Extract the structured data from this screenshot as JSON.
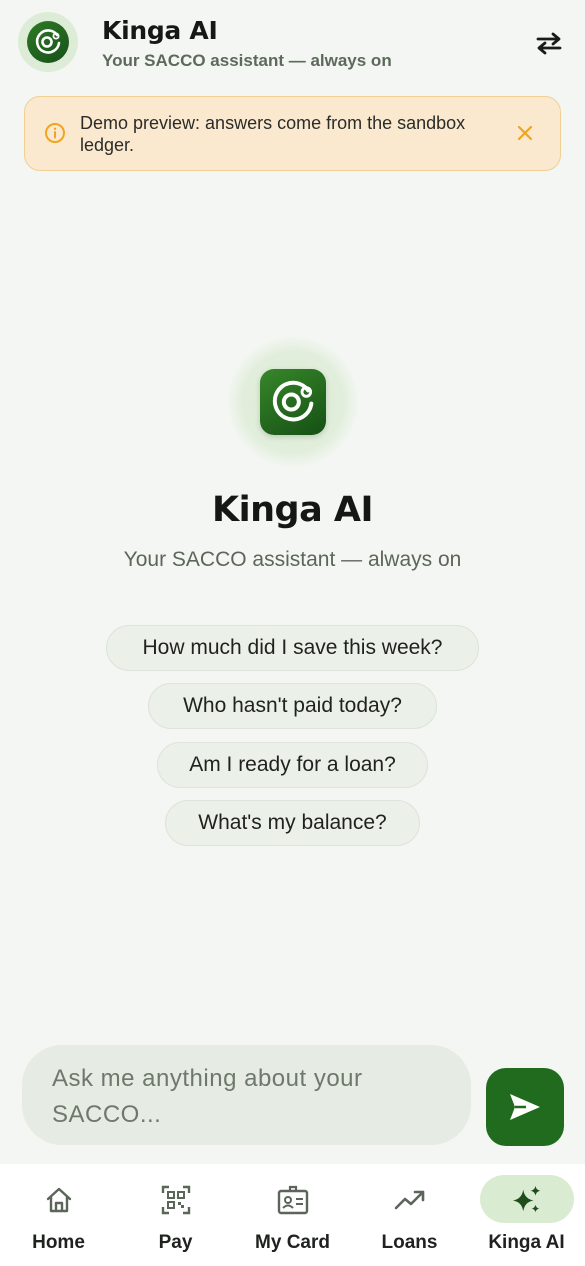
{
  "header": {
    "title": "Kinga AI",
    "subtitle": "Your SACCO assistant — always on",
    "avatar_icon": "kinga-logo-icon",
    "swap_icon": "swap-arrows-icon"
  },
  "banner": {
    "icon": "info-icon",
    "text": "Demo preview: answers come from the sandbox ledger.",
    "close_icon": "close-icon"
  },
  "hero": {
    "logo_icon": "kinga-logo-icon",
    "title": "Kinga AI",
    "subtitle": "Your SACCO assistant — always on"
  },
  "suggestions": [
    "How much did I save this week?",
    "Who hasn't paid today?",
    "Am I ready for a loan?",
    "What's my balance?"
  ],
  "composer": {
    "placeholder": "Ask me anything about your SACCO...",
    "value": "",
    "send_icon": "send-icon"
  },
  "nav": {
    "items": [
      {
        "label": "Home",
        "icon": "home-icon",
        "active": false
      },
      {
        "label": "Pay",
        "icon": "qr-code-icon",
        "active": false
      },
      {
        "label": "My Card",
        "icon": "id-card-icon",
        "active": false
      },
      {
        "label": "Loans",
        "icon": "trending-up-icon",
        "active": false
      },
      {
        "label": "Kinga AI",
        "icon": "sparkles-icon",
        "active": true
      }
    ]
  },
  "colors": {
    "brand": "#216b1e",
    "background": "#f3f6f2",
    "banner_bg": "#fbe9cf",
    "banner_accent": "#f0a51e",
    "active_pill": "#d9ecd2"
  }
}
